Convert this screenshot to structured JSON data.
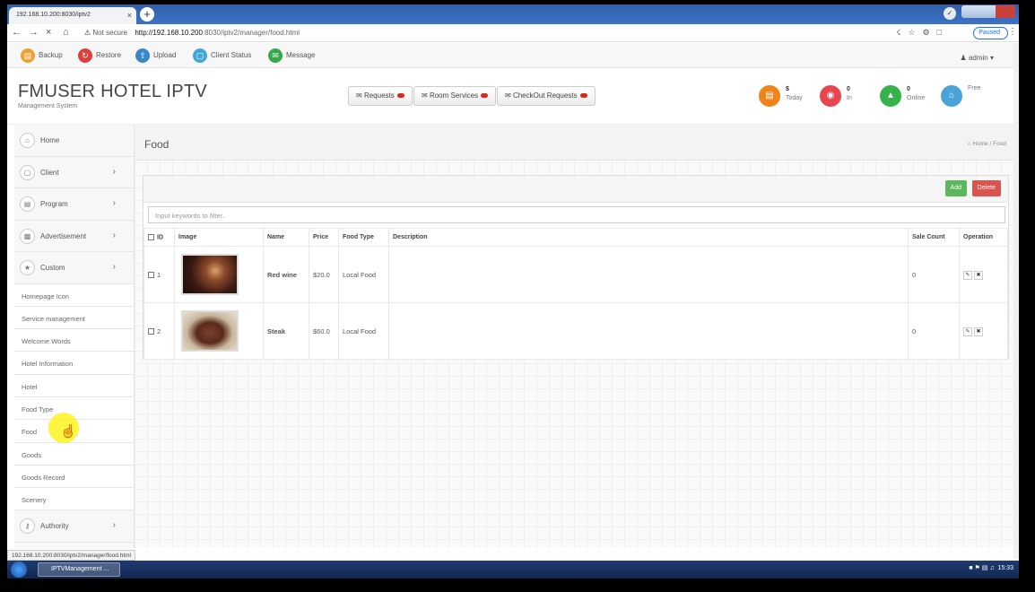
{
  "browser": {
    "tab_title": "192.168.10.200:8030/iptv2",
    "tab_audio": "░",
    "tab_close": "×",
    "new_tab": "+",
    "profile": "✓",
    "not_secure": "Not secure",
    "url_host": "http://192.168.10.200",
    "url_path": ":8030/iptv2/manager/food.html",
    "paused": "Paused",
    "status_url": "192.168.10.200:8030/iptv2/manager/food.html"
  },
  "toolbar": {
    "backup": "Backup",
    "restore": "Restore",
    "upload": "Upload",
    "client_status": "Client Status",
    "message": "Message",
    "admin": "admin"
  },
  "header": {
    "brand": "FMUSER HOTEL IPTV",
    "subtitle": "Management System",
    "requests": "Requests",
    "room_services": "Room Services",
    "checkout_requests": "CheckOut Requests",
    "stats": [
      {
        "value": "$",
        "label": "Today",
        "color": "#f0841c"
      },
      {
        "value": "0",
        "label": "In",
        "color": "#e8464f"
      },
      {
        "value": "0",
        "label": "Online",
        "color": "#35b34a"
      },
      {
        "value": "",
        "label": "Free",
        "color": "#4aa3d8"
      }
    ]
  },
  "sidebar": {
    "items": [
      {
        "label": "Home",
        "icon": "home-icon"
      },
      {
        "label": "Client",
        "icon": "monitor-icon"
      },
      {
        "label": "Program",
        "icon": "film-icon"
      },
      {
        "label": "Advertisement",
        "icon": "ad-icon"
      },
      {
        "label": "Custom",
        "icon": "star-icon"
      }
    ],
    "sub_items": [
      "Homepage Icon",
      "Service management",
      "Welcome Words",
      "Hotel Information",
      "Hotel",
      "Food Type",
      "Food",
      "Goods",
      "Goods Record",
      "Scenery"
    ],
    "authority": "Authority"
  },
  "main": {
    "page_title": "Food",
    "breadcrumb_home": "Home",
    "breadcrumb_sep": "/",
    "breadcrumb_current": "Food",
    "add": "Add",
    "delete": "Delete",
    "filter_placeholder": "Input keywords to filter.",
    "columns": [
      "ID",
      "Image",
      "Name",
      "Price",
      "Food Type",
      "Description",
      "Sale Count",
      "Operation"
    ],
    "rows": [
      {
        "id": "1",
        "name": "Red wine",
        "price": "$20.0",
        "food_type": "Local Food",
        "description": "",
        "sale_count": "0",
        "image": "wine"
      },
      {
        "id": "2",
        "name": "Steak",
        "price": "$60.0",
        "food_type": "Local Food",
        "description": "",
        "sale_count": "0",
        "image": "steak"
      }
    ]
  },
  "taskbar": {
    "task": "IPTVManagement ...",
    "time": "15:33"
  }
}
